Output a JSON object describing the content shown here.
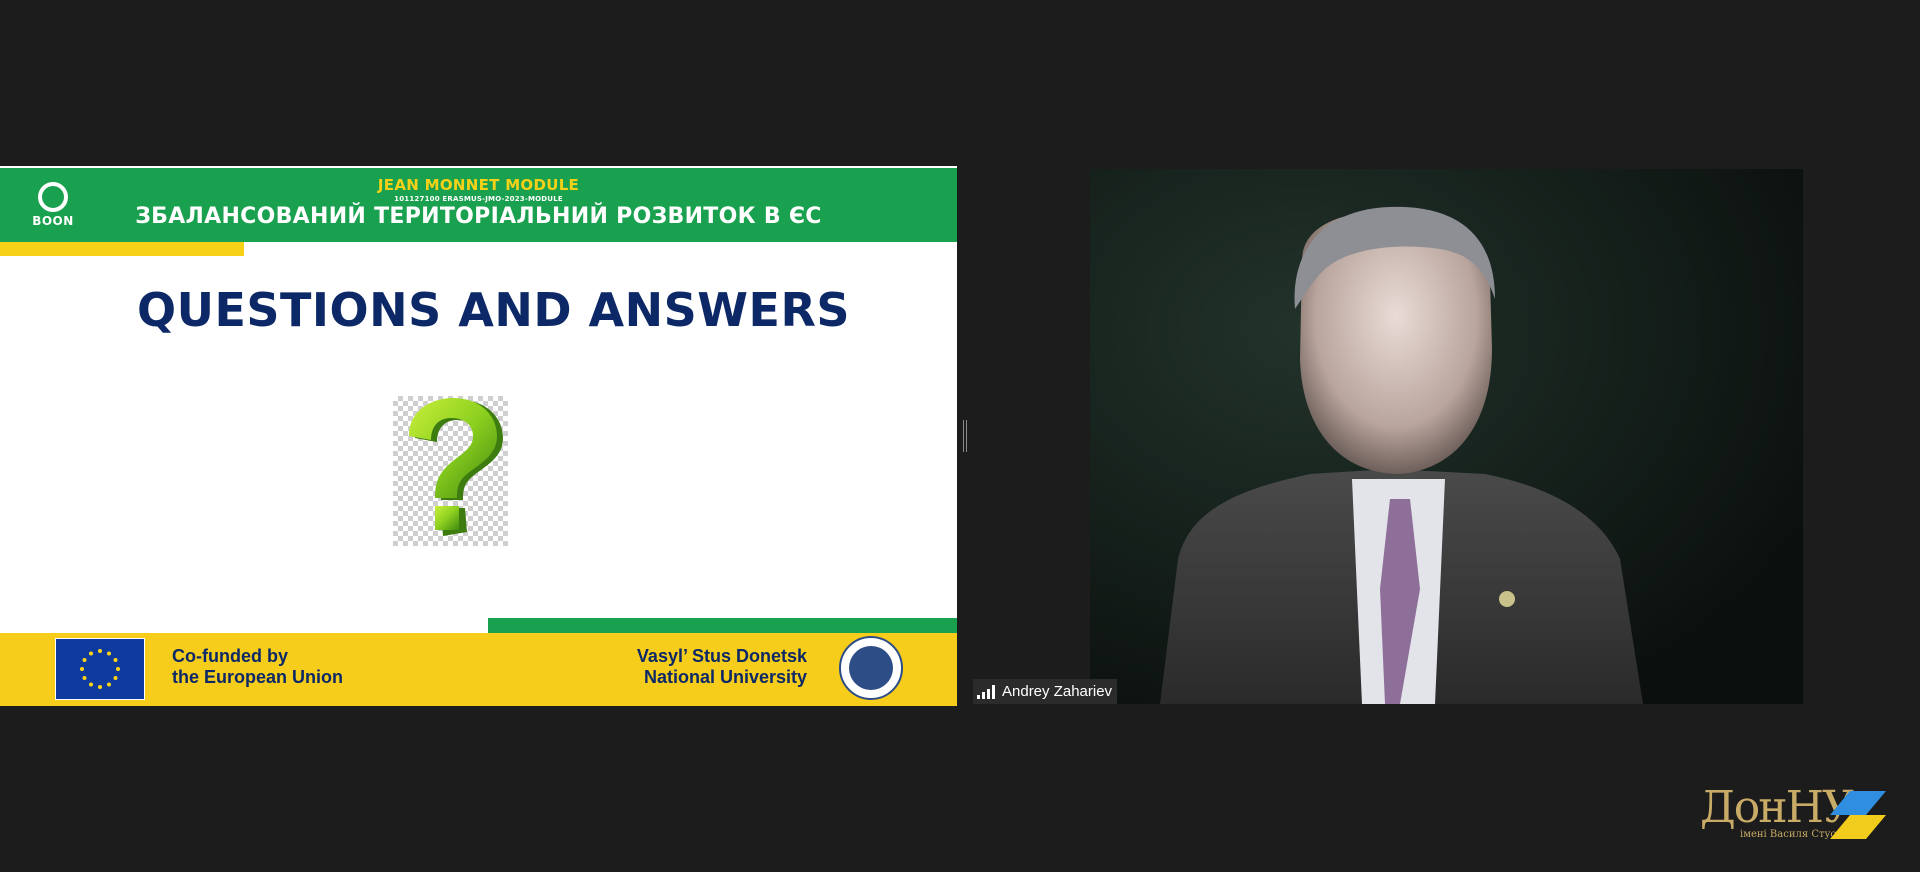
{
  "slide": {
    "logo_text": "BOON",
    "module_title": "JEAN MONNET MODULE",
    "module_code": "101127100 ERASMUS-JMO-2023-MODULE",
    "module_name": "ЗБАЛАНСОВАНИЙ ТЕРИТОРІАЛЬНИЙ РОЗВИТОК В ЄС",
    "heading": "QUESTIONS AND ANSWERS",
    "question_mark_icon": "question-mark-icon",
    "footer": {
      "cofunded_line1": "Co-funded by",
      "cofunded_line2": "the European Union",
      "university_line1": "Vasyl’ Stus Donetsk",
      "university_line2": "National University"
    },
    "colors": {
      "green": "#1aa14f",
      "yellow": "#f7cd1c",
      "navy": "#0c2866",
      "eu_blue": "#0f3a9e"
    }
  },
  "video": {
    "participant_name": "Andrey Zahariev",
    "signal_icon": "signal-strength-icon"
  },
  "watermark": {
    "text": "ДонНУ",
    "subtext": "імені Василя Стуса"
  }
}
